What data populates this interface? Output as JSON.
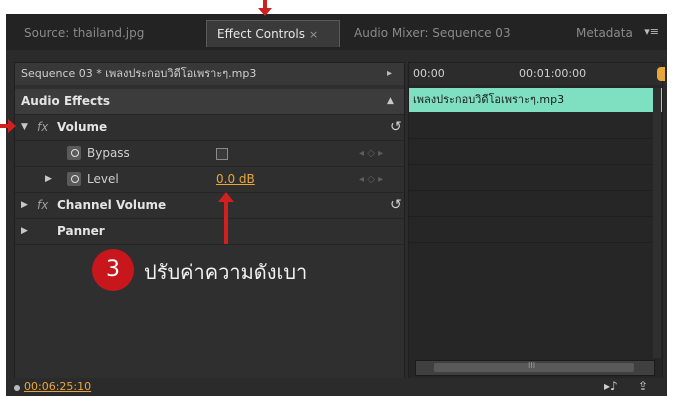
{
  "tabs": [
    {
      "label": "Source: thailand.jpg"
    },
    {
      "label": "Effect Controls",
      "close": "×"
    },
    {
      "label": "Audio Mixer: Sequence 03"
    },
    {
      "label": "Metadata"
    }
  ],
  "tab_menu_icon": "▾≡",
  "sequence_label": "Sequence 03 * เพลงประกอบวิดีโอเพราะๆ.mp3",
  "sequence_arrow": "▸",
  "audio_effects_label": "Audio Effects",
  "audio_effects_arrow": "▲",
  "effects": {
    "volume": {
      "label": "Volume",
      "reset_icon": "↺"
    },
    "bypass": {
      "label": "Bypass"
    },
    "level": {
      "label": "Level",
      "value": "0.0 dB"
    },
    "channel_volume": {
      "label": "Channel Volume",
      "reset_icon": "↺"
    },
    "panner": {
      "label": "Panner"
    }
  },
  "fx_glyph": "fx",
  "keyframe_nav": "◂ ◇ ▸",
  "timeline": {
    "start": "00:00",
    "mark": "00:01:00:00",
    "clip_name": "เพลงประกอบวิดีโอเพราะๆ.mp3",
    "scroll_mark": "III"
  },
  "footer": {
    "timecode": "00:06:25:10",
    "play_icon": "▸♪",
    "export_icon": "⇪"
  },
  "annotation": {
    "step_number": "3",
    "step_text": "ปรับค่าความดังเบา"
  },
  "colors": {
    "accent_orange": "#e8a73a",
    "clip_green": "#7ee0c0",
    "annotation_red": "#d02020"
  }
}
